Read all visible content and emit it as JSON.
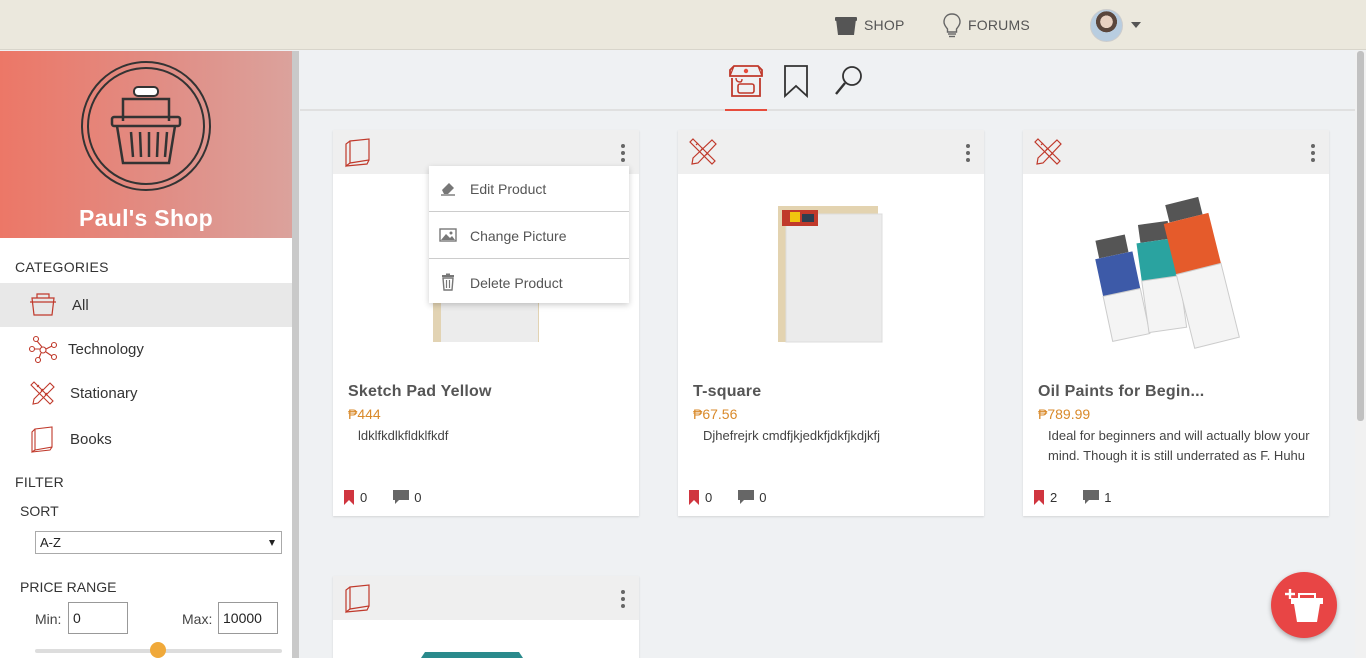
{
  "topbar": {
    "shop_label": "SHOP",
    "forums_label": "FORUMS"
  },
  "sidebar": {
    "brand_name": "Paul's Shop",
    "categories_title": "CATEGORIES",
    "categories": [
      {
        "label": "All",
        "icon": "basket-icon",
        "active": true
      },
      {
        "label": "Technology",
        "icon": "network-icon",
        "active": false
      },
      {
        "label": "Stationary",
        "icon": "pencil-ruler-icon",
        "active": false
      },
      {
        "label": "Books",
        "icon": "book-icon",
        "active": false
      }
    ],
    "filter_title": "FILTER",
    "sort_label": "SORT",
    "sort_value": "A-Z",
    "price_range_label": "PRICE RANGE",
    "min_label": "Min:",
    "min_value": "0",
    "max_label": "Max:",
    "max_value": "10000",
    "price_slider_value": 500
  },
  "products": [
    {
      "title": "Sketch Pad Yellow",
      "price": "₱444",
      "description": "ldklfkdlkfldklfkdf",
      "bookmarks": "0",
      "comments": "0",
      "category_icon": "book-icon"
    },
    {
      "title": "T-square",
      "price": "₱67.56",
      "description": "Djhefrejrk cmdfjkjedkfjdkfjkdjkfj",
      "bookmarks": "0",
      "comments": "0",
      "category_icon": "pencil-ruler-icon"
    },
    {
      "title": "Oil Paints for Begin...",
      "price": "₱789.99",
      "description": "Ideal for beginners and will actually blow your mind. Though it is still underrated as F. Huhu",
      "bookmarks": "2",
      "comments": "1",
      "category_icon": "pencil-ruler-icon"
    },
    {
      "category_icon": "book-icon"
    }
  ],
  "context_menu": {
    "items": [
      {
        "label": "Edit Product",
        "icon": "eraser-icon"
      },
      {
        "label": "Change Picture",
        "icon": "image-icon"
      },
      {
        "label": "Delete Product",
        "icon": "trash-icon"
      }
    ]
  },
  "colors": {
    "accent": "#e74c3c",
    "price": "#d98a2b",
    "brand_gradient_start": "#ec7767",
    "brand_gradient_end": "#dba29c",
    "fab": "#e84545"
  }
}
